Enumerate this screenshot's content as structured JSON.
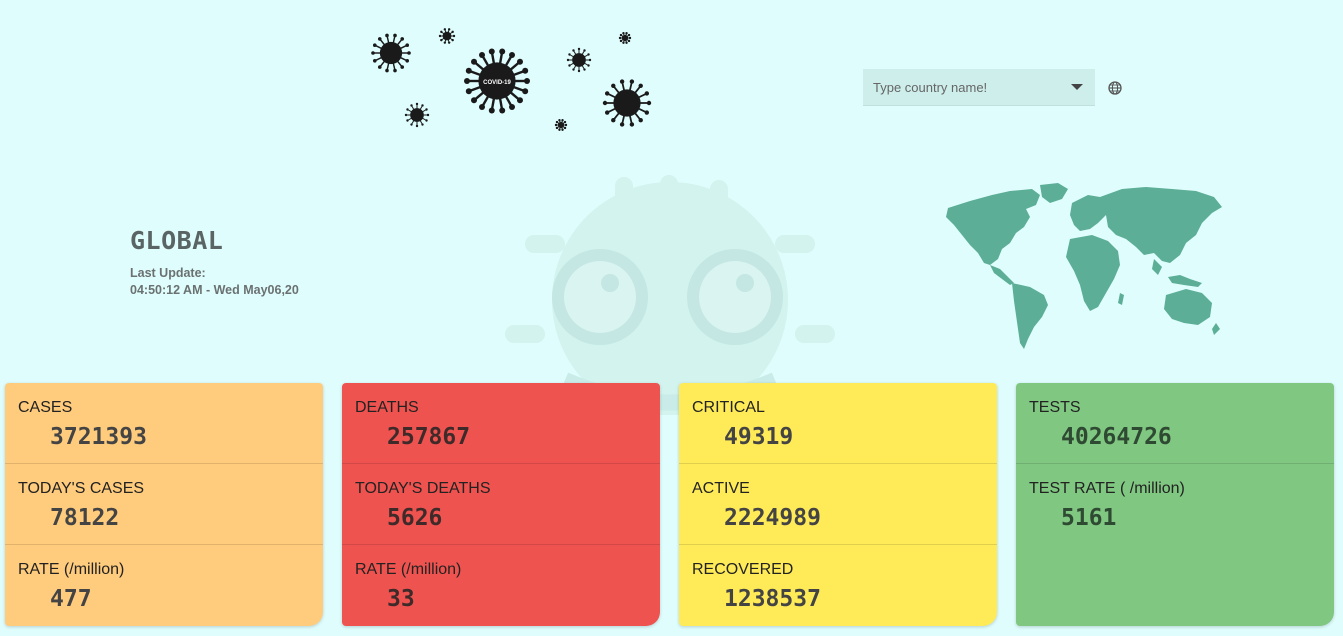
{
  "banner": {
    "virus_text": "COVID-19",
    "icon": "virus-cluster-icon"
  },
  "search": {
    "placeholder": "Type country name!",
    "dropdown_icon": "chevron-down-icon",
    "globe_icon": "globe-icon"
  },
  "header": {
    "title": "GLOBAL",
    "update_label": "Last Update:",
    "update_time": "04:50:12 AM - Wed May06,20"
  },
  "colors": {
    "background": "#dffdfd",
    "cases_card": "#ffcb7c",
    "deaths_card": "#ef5350",
    "critical_card": "#ffeb58",
    "tests_card": "#80c781",
    "map": "#5cae96"
  },
  "cards": [
    {
      "cells": [
        {
          "label": "CASES",
          "value": "3721393"
        },
        {
          "label": "TODAY'S CASES",
          "value": "78122"
        },
        {
          "label": "RATE (/million)",
          "value": "477"
        }
      ]
    },
    {
      "cells": [
        {
          "label": "DEATHS",
          "value": "257867"
        },
        {
          "label": "TODAY'S DEATHS",
          "value": "5626"
        },
        {
          "label": "RATE (/million)",
          "value": "33"
        }
      ]
    },
    {
      "cells": [
        {
          "label": "CRITICAL",
          "value": "49319"
        },
        {
          "label": "ACTIVE",
          "value": "2224989"
        },
        {
          "label": "RECOVERED",
          "value": "1238537"
        }
      ]
    },
    {
      "cells": [
        {
          "label": "TESTS",
          "value": "40264726"
        },
        {
          "label": "TEST RATE ( /million)",
          "value": "5161"
        }
      ]
    }
  ]
}
